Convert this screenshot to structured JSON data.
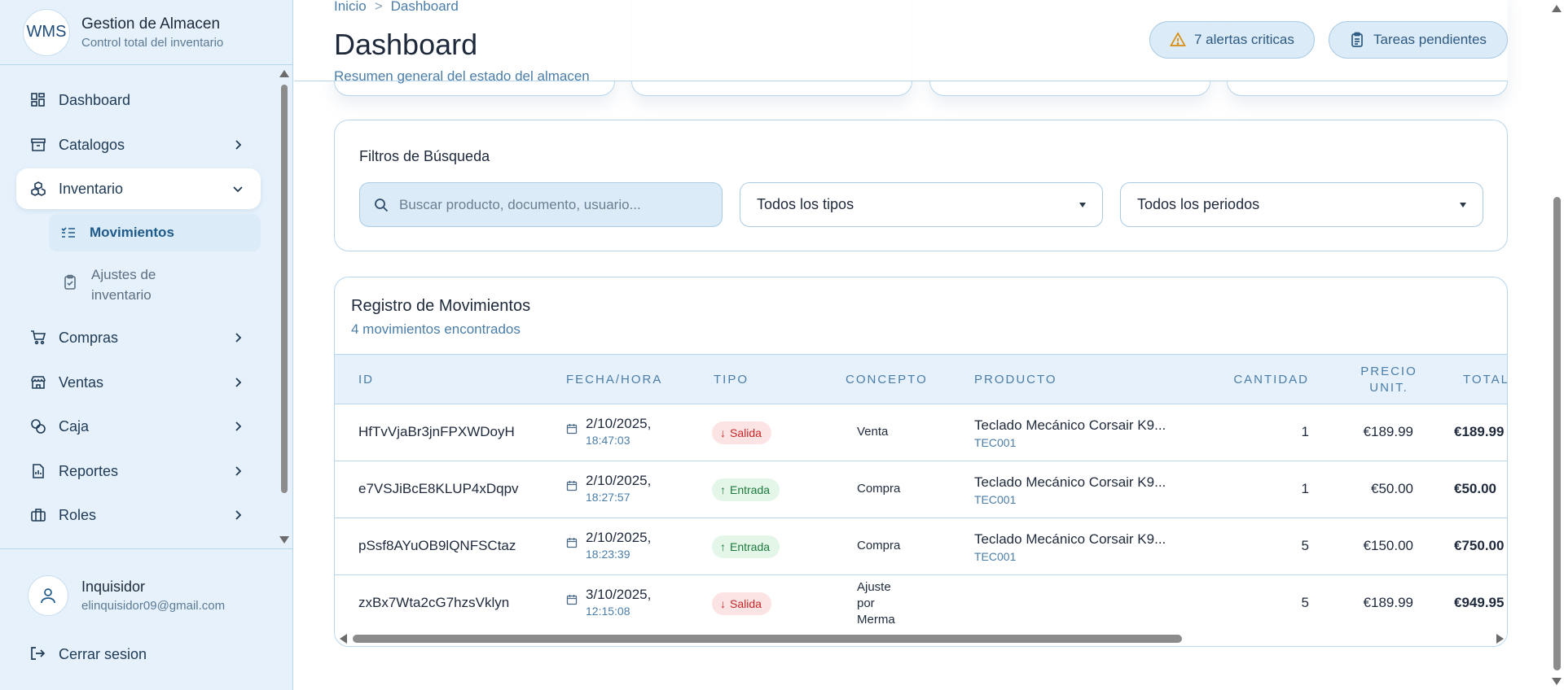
{
  "brand": {
    "logo": "WMS",
    "title": "Gestion de Almacen",
    "subtitle": "Control total del inventario"
  },
  "sidebar": {
    "items": [
      {
        "label": "Dashboard",
        "icon": "dashboard-icon"
      },
      {
        "label": "Catalogos",
        "icon": "archive-icon"
      },
      {
        "label": "Inventario",
        "icon": "boxes-icon"
      },
      {
        "label": "Compras",
        "icon": "cart-icon"
      },
      {
        "label": "Ventas",
        "icon": "store-icon"
      },
      {
        "label": "Caja",
        "icon": "coins-icon"
      },
      {
        "label": "Reportes",
        "icon": "report-icon"
      },
      {
        "label": "Roles",
        "icon": "briefcase-icon"
      }
    ],
    "subitems": [
      {
        "label": "Movimientos",
        "icon": "list-check-icon"
      },
      {
        "label": "Ajustes de inventario",
        "icon": "clipboard-check-icon"
      }
    ]
  },
  "user": {
    "name": "Inquisidor",
    "email": "elinquisidor09@gmail.com",
    "logout": "Cerrar sesion"
  },
  "header": {
    "breadcrumb": [
      "Inicio",
      "Dashboard"
    ],
    "breadcrumb_sep": ">",
    "title": "Dashboard",
    "subtitle": "Resumen general del estado del almacen",
    "alerts_label": "7 alertas criticas",
    "tasks_label": "Tareas pendientes"
  },
  "filters": {
    "title": "Filtros de Búsqueda",
    "search_placeholder": "Buscar producto, documento, usuario...",
    "type_selected": "Todos los tipos",
    "period_selected": "Todos los periodos"
  },
  "table": {
    "title": "Registro de Movimientos",
    "count": "4 movimientos encontrados",
    "columns": [
      "ID",
      "FECHA/HORA",
      "TIPO",
      "CONCEPTO",
      "PRODUCTO",
      "CANTIDAD",
      "PRECIO UNIT.",
      "TOTAL"
    ],
    "rows": [
      {
        "id": "HfTvVjaBr3jnFPXWDoyH",
        "date": "2/10/2025,",
        "time": "18:47:03",
        "type": "Salida",
        "concept": "Venta",
        "product": "Teclado Mecánico Corsair K9...",
        "code": "TEC001",
        "qty": "1",
        "price": "€189.99",
        "total": "€189.99"
      },
      {
        "id": "e7VSJiBcE8KLUP4xDqpv",
        "date": "2/10/2025,",
        "time": "18:27:57",
        "type": "Entrada",
        "concept": "Compra",
        "product": "Teclado Mecánico Corsair K9...",
        "code": "TEC001",
        "qty": "1",
        "price": "€50.00",
        "total": "€50.00"
      },
      {
        "id": "pSsf8AYuOB9lQNFSCtaz",
        "date": "2/10/2025,",
        "time": "18:23:39",
        "type": "Entrada",
        "concept": "Compra",
        "product": "Teclado Mecánico Corsair K9...",
        "code": "TEC001",
        "qty": "5",
        "price": "€150.00",
        "total": "€750.00"
      },
      {
        "id": "zxBx7Wta2cG7hzsVklyn",
        "date": "3/10/2025,",
        "time": "12:15:08",
        "type": "Salida",
        "concept": "Ajuste por Merma",
        "product": "",
        "code": "",
        "qty": "5",
        "price": "€189.99",
        "total": "€949.95"
      }
    ]
  },
  "colors": {
    "accent": "#4a7da8",
    "sidebar_bg": "#e6f1fb",
    "salida": "#c52727",
    "entrada": "#1d7a3c"
  }
}
